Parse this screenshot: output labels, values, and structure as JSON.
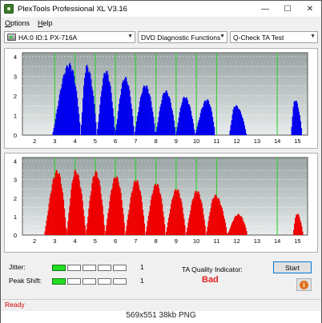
{
  "window": {
    "title": "PlexTools Professional XL V3.16",
    "minimize_glyph": "—",
    "maximize_glyph": "☐",
    "close_glyph": "✕"
  },
  "menu": {
    "options": {
      "underline": "O",
      "rest": "ptions"
    },
    "help": {
      "underline": "H",
      "rest": "elp"
    }
  },
  "toolbar": {
    "drive": "HA:0 ID:1  PX-716A",
    "function": "DVD Diagnostic Functions",
    "test": "Q-Check TA Test"
  },
  "chart_data": [
    {
      "type": "bar",
      "name": "top-blue",
      "color": "#0000ee",
      "x_ticks": [
        "2",
        "3",
        "4",
        "5",
        "6",
        "7",
        "8",
        "9",
        "10",
        "11",
        "12",
        "13",
        "14",
        "15"
      ],
      "y_ticks": [
        "0",
        "0.5",
        "1",
        "1.5",
        "2",
        "2.5",
        "3",
        "3.5",
        "4"
      ],
      "xlim": [
        1.4,
        15.5
      ],
      "ylim": [
        0,
        4.2
      ],
      "green_lines_x": [
        3,
        4,
        5,
        6,
        7,
        8,
        9,
        10,
        11,
        14
      ],
      "peaks": [
        {
          "x": 3.7,
          "peak": 3.7,
          "start": 2.85,
          "end": 4.25
        },
        {
          "x": 4.55,
          "peak": 3.6,
          "start": 4.25,
          "end": 5.05
        },
        {
          "x": 5.5,
          "peak": 3.35,
          "start": 5.05,
          "end": 5.95
        },
        {
          "x": 6.45,
          "peak": 3.0,
          "start": 5.95,
          "end": 6.9
        },
        {
          "x": 7.45,
          "peak": 2.6,
          "start": 6.9,
          "end": 7.95
        },
        {
          "x": 8.45,
          "peak": 2.3,
          "start": 7.95,
          "end": 8.95
        },
        {
          "x": 9.4,
          "peak": 2.0,
          "start": 8.95,
          "end": 9.9
        },
        {
          "x": 10.5,
          "peak": 1.85,
          "start": 9.9,
          "end": 10.9
        },
        {
          "x": 11.9,
          "peak": 1.55,
          "start": 11.6,
          "end": 12.45
        },
        {
          "x": 14.85,
          "peak": 1.85,
          "start": 14.65,
          "end": 15.2
        }
      ]
    },
    {
      "type": "bar",
      "name": "bottom-red",
      "color": "#ee0000",
      "x_ticks": [
        "2",
        "3",
        "4",
        "5",
        "6",
        "7",
        "8",
        "9",
        "10",
        "11",
        "12",
        "13",
        "14",
        "15"
      ],
      "y_ticks": [
        "0",
        "0.5",
        "1",
        "1.5",
        "2",
        "2.5",
        "3",
        "3.5",
        "4"
      ],
      "xlim": [
        1.4,
        15.5
      ],
      "ylim": [
        0,
        4.2
      ],
      "green_lines_x": [
        3,
        4,
        5,
        6,
        7,
        8,
        9,
        10,
        11,
        14
      ],
      "peaks": [
        {
          "x": 3.1,
          "peak": 3.55,
          "start": 2.45,
          "end": 3.55
        },
        {
          "x": 4.0,
          "peak": 3.55,
          "start": 3.55,
          "end": 4.5
        },
        {
          "x": 5.0,
          "peak": 3.5,
          "start": 4.5,
          "end": 5.45
        },
        {
          "x": 6.0,
          "peak": 3.25,
          "start": 5.45,
          "end": 6.45
        },
        {
          "x": 7.0,
          "peak": 3.05,
          "start": 6.45,
          "end": 7.45
        },
        {
          "x": 8.0,
          "peak": 2.85,
          "start": 7.45,
          "end": 8.45
        },
        {
          "x": 9.0,
          "peak": 2.55,
          "start": 8.45,
          "end": 9.45
        },
        {
          "x": 10.0,
          "peak": 2.45,
          "start": 9.45,
          "end": 10.45
        },
        {
          "x": 10.9,
          "peak": 2.2,
          "start": 10.45,
          "end": 11.5
        },
        {
          "x": 12.05,
          "peak": 1.15,
          "start": 11.5,
          "end": 12.5
        },
        {
          "x": 14.95,
          "peak": 1.2,
          "start": 14.75,
          "end": 15.25
        }
      ]
    }
  ],
  "quality": {
    "jitter_label": "Jitter:",
    "peak_shift_label": "Peak Shift:",
    "jitter_value": "1",
    "peak_shift_value": "1",
    "jitter_level": 1,
    "peak_shift_level": 1,
    "segments": 5,
    "ta_indicator_label": "TA Quality Indicator:",
    "ta_result": "Bad",
    "ta_result_color": "#e02020",
    "start_label": "Start",
    "info_icon": "info-icon"
  },
  "status": {
    "text": "Ready"
  },
  "caption": "569x551  38kb  PNG"
}
